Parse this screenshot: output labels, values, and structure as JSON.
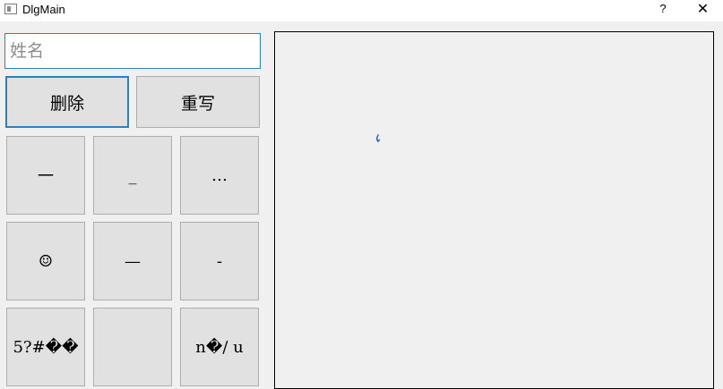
{
  "window": {
    "title": "DlgMain",
    "help_label": "?",
    "close_label": "✕"
  },
  "form": {
    "name_placeholder": "姓名",
    "name_value": ""
  },
  "actions": {
    "delete_label": "删除",
    "rewrite_label": "重写"
  },
  "candidates": [
    "一",
    "_",
    "…",
    "☺",
    "—",
    "-",
    "5?#��",
    "",
    "n�/ u"
  ],
  "colors": {
    "focus": "#2f7fbf",
    "stroke": "#1f6fbf"
  }
}
